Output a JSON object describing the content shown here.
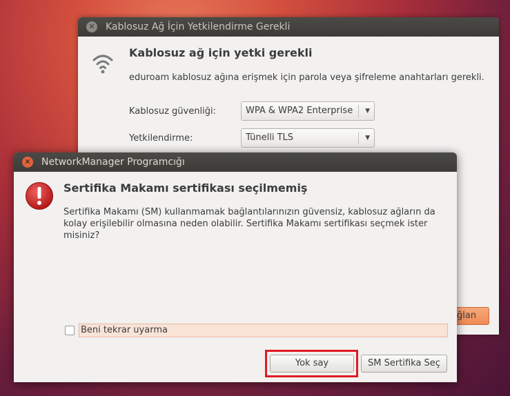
{
  "back_window": {
    "title": "Kablosuz Ağ İçin Yetkilendirme Gerekli",
    "heading": "Kablosuz ağ için yetki gerekli",
    "description": "eduroam kablosuz ağına erişmek için parola veya şifreleme anahtarları gerekli.",
    "security_label": "Kablosuz güvenliği:",
    "security_value": "WPA & WPA2 Enterprise",
    "auth_label": "Yetkilendirme:",
    "auth_value": "Tünelli TLS",
    "partial_button_label": "ğlan"
  },
  "dialog": {
    "title": "NetworkManager Programcığı",
    "heading": "Sertifika Makamı sertifikası seçilmemiş",
    "message": "Sertifika Makamı (SM) kullanmamak bağlantılarınızın güvensiz, kablosuz ağların da kolay erişilebilir olmasına neden olabilir. Sertifika Makamı sertifikası seçmek ister misiniz?",
    "checkbox_label": "Beni tekrar uyarma",
    "checkbox_checked": false,
    "ignore_button": "Yok say",
    "choose_cert_button": "SM Sertifika Seç"
  },
  "colors": {
    "highlight": "#e01b22",
    "close_button": "#e0643e",
    "alert_icon": "#d92b2b"
  },
  "icons": {
    "back_window_icon": "wifi-icon",
    "dialog_icon": "alert-icon"
  }
}
